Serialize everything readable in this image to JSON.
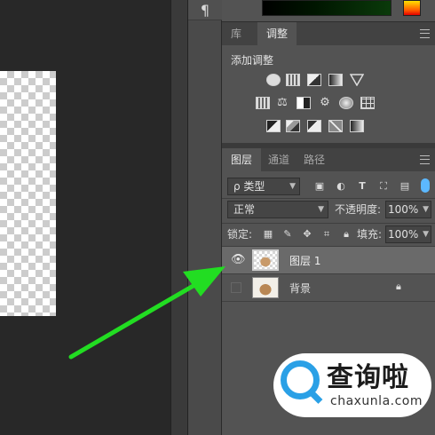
{
  "colors": {
    "accent_arrow": "#22dd22",
    "panel": "#535353",
    "canvas_bg": "#282828",
    "watermark_blue": "#2aa0e6"
  },
  "left_strip": {
    "paragraph_icon": "¶"
  },
  "adjustments": {
    "tabs": [
      {
        "label": "库"
      },
      {
        "label": "调整"
      }
    ],
    "title": "添加调整",
    "icons": [
      "brightness-icon",
      "levels-icon",
      "curves-icon",
      "exposure-icon",
      "vibrance-icon",
      "hue-saturation-icon",
      "color-balance-icon",
      "black-white-icon",
      "photo-filter-icon",
      "channel-mixer-icon",
      "color-lookup-icon",
      "invert-icon",
      "posterize-icon",
      "threshold-icon",
      "selective-color-icon",
      "gradient-map-icon"
    ]
  },
  "layers": {
    "tabs": [
      {
        "label": "图层"
      },
      {
        "label": "通道"
      },
      {
        "label": "路径"
      }
    ],
    "filter": {
      "label": "ρ 类型"
    },
    "blend": {
      "mode": "正常",
      "opacity_label": "不透明度:",
      "opacity_value": "100%"
    },
    "lock": {
      "label": "锁定:",
      "fill_label": "填充:",
      "fill_value": "100%"
    },
    "rows": [
      {
        "name": "图层 1",
        "visible": true,
        "selected": true
      },
      {
        "name": "背景",
        "visible": false,
        "locked": true
      }
    ]
  },
  "watermark": {
    "title": "查询啦",
    "url": "chaxunla.com"
  }
}
